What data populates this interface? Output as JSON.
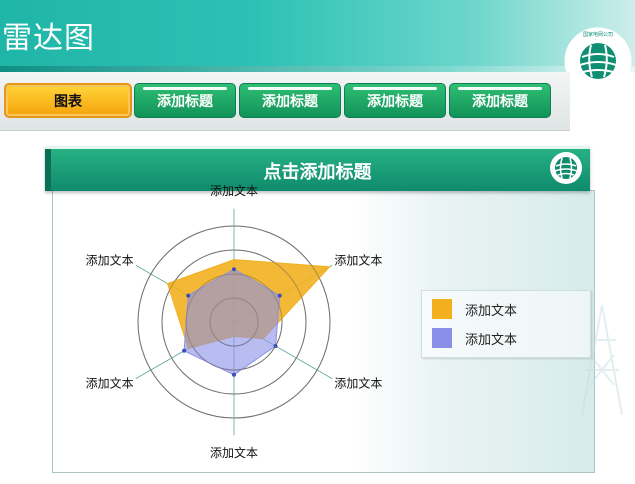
{
  "slide": {
    "title": "雷达图"
  },
  "tabs": [
    {
      "label": "图表",
      "active": true
    },
    {
      "label": "添加标题",
      "active": false
    },
    {
      "label": "添加标题",
      "active": false
    },
    {
      "label": "添加标题",
      "active": false
    },
    {
      "label": "添加标题",
      "active": false
    }
  ],
  "logo": {
    "text": "STATE GRID CORPORATION OF CHINA",
    "cn_text": "国家电网公司"
  },
  "panel": {
    "title": "点击添加标题"
  },
  "colors": {
    "series1": "#f2b01f",
    "series2": "#8a8fe8",
    "header_green": "#18a078",
    "teal": "#2cc1b4"
  },
  "chart_data": {
    "type": "radar",
    "categories": [
      "添加文本",
      "添加文本",
      "添加文本",
      "添加文本",
      "添加文本",
      "添加文本"
    ],
    "series": [
      {
        "name": "添加文本",
        "values": [
          65,
          115,
          35,
          15,
          55,
          80
        ]
      },
      {
        "name": "添加文本",
        "values": [
          55,
          55,
          50,
          55,
          60,
          55
        ]
      }
    ],
    "rlim": [
      0,
      100
    ],
    "rings": 4,
    "legend": "right"
  }
}
